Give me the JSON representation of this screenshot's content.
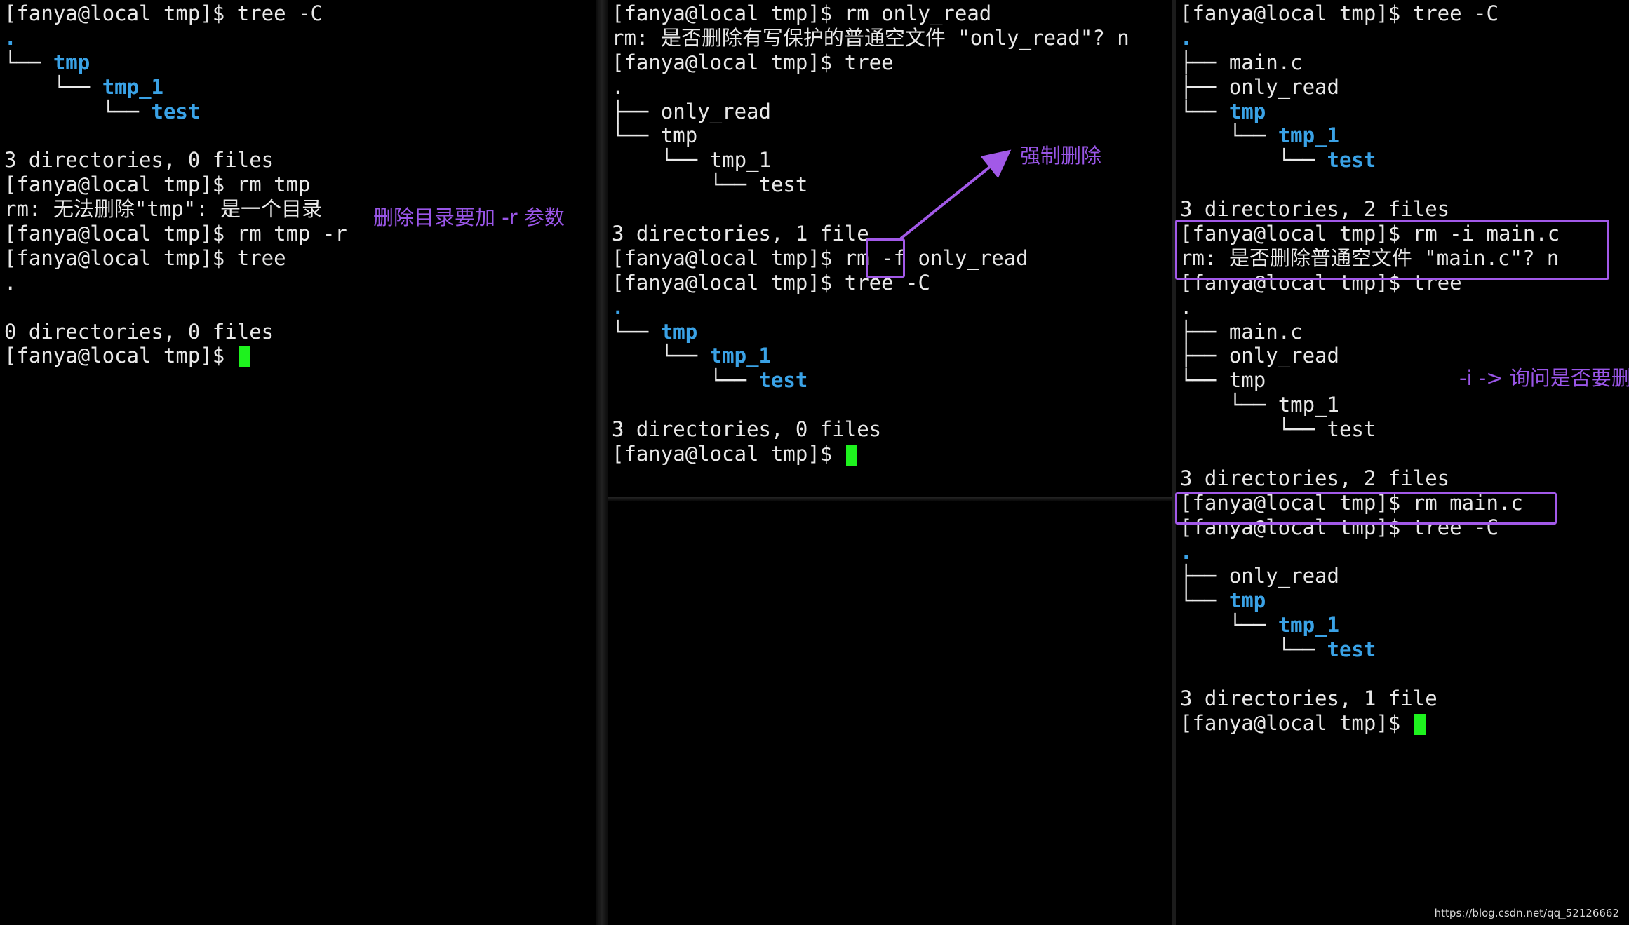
{
  "left_terminal": {
    "lines": [
      {
        "text": "[fanya@local tmp]$ tree -C"
      },
      {
        "text": ".",
        "dir": true
      },
      {
        "prefix": "└── ",
        "name": "tmp",
        "dir": true
      },
      {
        "prefix": "    └── ",
        "name": "tmp_1",
        "dir": true
      },
      {
        "prefix": "        └── ",
        "name": "test",
        "dir": true
      },
      {
        "text": ""
      },
      {
        "text": "3 directories, 0 files"
      },
      {
        "text": "[fanya@local tmp]$ rm tmp"
      },
      {
        "text": "rm: 无法删除\"tmp\": 是一个目录"
      },
      {
        "text": "[fanya@local tmp]$ rm tmp -r"
      },
      {
        "text": "[fanya@local tmp]$ tree"
      },
      {
        "text": "."
      },
      {
        "text": ""
      },
      {
        "text": "0 directories, 0 files"
      },
      {
        "text": "[fanya@local tmp]$ ",
        "cursor": true
      }
    ]
  },
  "middle_terminal": {
    "lines": [
      {
        "text": "[fanya@local tmp]$ rm only_read"
      },
      {
        "text": "rm: 是否删除有写保护的普通空文件 \"only_read\"? n"
      },
      {
        "text": "[fanya@local tmp]$ tree"
      },
      {
        "text": "."
      },
      {
        "prefix": "├── ",
        "name": "only_read"
      },
      {
        "prefix": "└── ",
        "name": "tmp"
      },
      {
        "prefix": "    └── ",
        "name": "tmp_1"
      },
      {
        "prefix": "        └── ",
        "name": "test"
      },
      {
        "text": ""
      },
      {
        "text": "3 directories, 1 file"
      },
      {
        "text": "[fanya@local tmp]$ rm -f only_read"
      },
      {
        "text": "[fanya@local tmp]$ tree -C"
      },
      {
        "text": ".",
        "dir": true
      },
      {
        "prefix": "└── ",
        "name": "tmp",
        "dir": true
      },
      {
        "prefix": "    └── ",
        "name": "tmp_1",
        "dir": true
      },
      {
        "prefix": "        └── ",
        "name": "test",
        "dir": true
      },
      {
        "text": ""
      },
      {
        "text": "3 directories, 0 files"
      },
      {
        "text": "[fanya@local tmp]$ ",
        "cursor": true
      }
    ]
  },
  "right_terminal": {
    "lines": [
      {
        "text": "[fanya@local tmp]$ tree -C"
      },
      {
        "text": ".",
        "dir": true
      },
      {
        "prefix": "├── ",
        "name": "main.c"
      },
      {
        "prefix": "├── ",
        "name": "only_read"
      },
      {
        "prefix": "└── ",
        "name": "tmp",
        "dir": true
      },
      {
        "prefix": "    └── ",
        "name": "tmp_1",
        "dir": true
      },
      {
        "prefix": "        └── ",
        "name": "test",
        "dir": true
      },
      {
        "text": ""
      },
      {
        "text": "3 directories, 2 files"
      },
      {
        "text": "[fanya@local tmp]$ rm -i main.c"
      },
      {
        "text": "rm: 是否删除普通空文件 \"main.c\"? n"
      },
      {
        "text": "[fanya@local tmp]$ tree"
      },
      {
        "text": "."
      },
      {
        "prefix": "├── ",
        "name": "main.c"
      },
      {
        "prefix": "├── ",
        "name": "only_read"
      },
      {
        "prefix": "└── ",
        "name": "tmp"
      },
      {
        "prefix": "    └── ",
        "name": "tmp_1"
      },
      {
        "prefix": "        └── ",
        "name": "test"
      },
      {
        "text": ""
      },
      {
        "text": "3 directories, 2 files"
      },
      {
        "text": "[fanya@local tmp]$ rm main.c"
      },
      {
        "text": "[fanya@local tmp]$ tree -C"
      },
      {
        "text": ".",
        "dir": true
      },
      {
        "prefix": "├── ",
        "name": "only_read"
      },
      {
        "prefix": "└── ",
        "name": "tmp",
        "dir": true
      },
      {
        "prefix": "    └── ",
        "name": "tmp_1",
        "dir": true
      },
      {
        "prefix": "        └── ",
        "name": "test",
        "dir": true
      },
      {
        "text": ""
      },
      {
        "text": "3 directories, 1 file"
      },
      {
        "text": "[fanya@local tmp]$ ",
        "cursor": true
      }
    ]
  },
  "annotations": {
    "remove_dir_note": "删除目录要加 -r 参数",
    "force_note": "强制删除",
    "interactive_note": "-i -> 询问是否要删"
  },
  "watermark": "https://blog.csdn.net/qq_52126662",
  "colors": {
    "background": "#000000",
    "text": "#e8e8e8",
    "directory": "#3aa2e6",
    "cursor": "#1ef21e",
    "annotation": "#9a56e8"
  }
}
